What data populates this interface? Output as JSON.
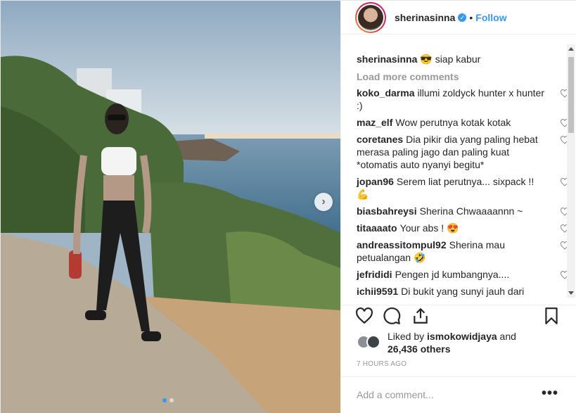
{
  "post": {
    "username": "sherinasinna",
    "separator": "•",
    "follow_label": "Follow",
    "verified_icon": "✓",
    "caption_user": "sherinasinna",
    "caption_text": "😎 siap kabur",
    "load_more": "Load more comments",
    "comments": [
      {
        "user": "koko_darma",
        "text": "illumi zoldyck hunter x hunter :)"
      },
      {
        "user": "maz_elf",
        "text": "Wow perutnya kotak kotak"
      },
      {
        "user": "coretanes",
        "text": "Dia pikir dia yang paling hebat merasa paling jago dan paling kuat *otomatis auto nyanyi begitu*"
      },
      {
        "user": "jopan96",
        "text": "Serem liat perutnya... sixpack !! 💪"
      },
      {
        "user": "biasbahreysi",
        "text": "Sherina Chwaaaannn ~"
      },
      {
        "user": "titaaaato",
        "text": "Your abs ! 😍"
      },
      {
        "user": "andreassitompul92",
        "text": "Sherina mau petualangan 🤣"
      },
      {
        "user": "jefrididi",
        "text": "Pengen jd kumbangnya...."
      },
      {
        "user": "ichii9591",
        "text": "Di bukit yang sunyi jauh dari"
      }
    ],
    "liked_prefix": "Liked by",
    "liked_user": "ismokowidjaya",
    "liked_and": "and",
    "liked_count": "26,436 others",
    "timestamp": "7 HOURS AGO",
    "add_comment_placeholder": "Add a comment...",
    "more_label": "•••",
    "next_label": "›"
  },
  "colors": {
    "accent": "#3897f0",
    "text": "#262626",
    "muted": "#999999"
  },
  "icons": [
    "heart-icon",
    "comment-icon",
    "share-icon",
    "bookmark-icon",
    "next-arrow-icon",
    "verified-icon",
    "more-options-icon"
  ]
}
